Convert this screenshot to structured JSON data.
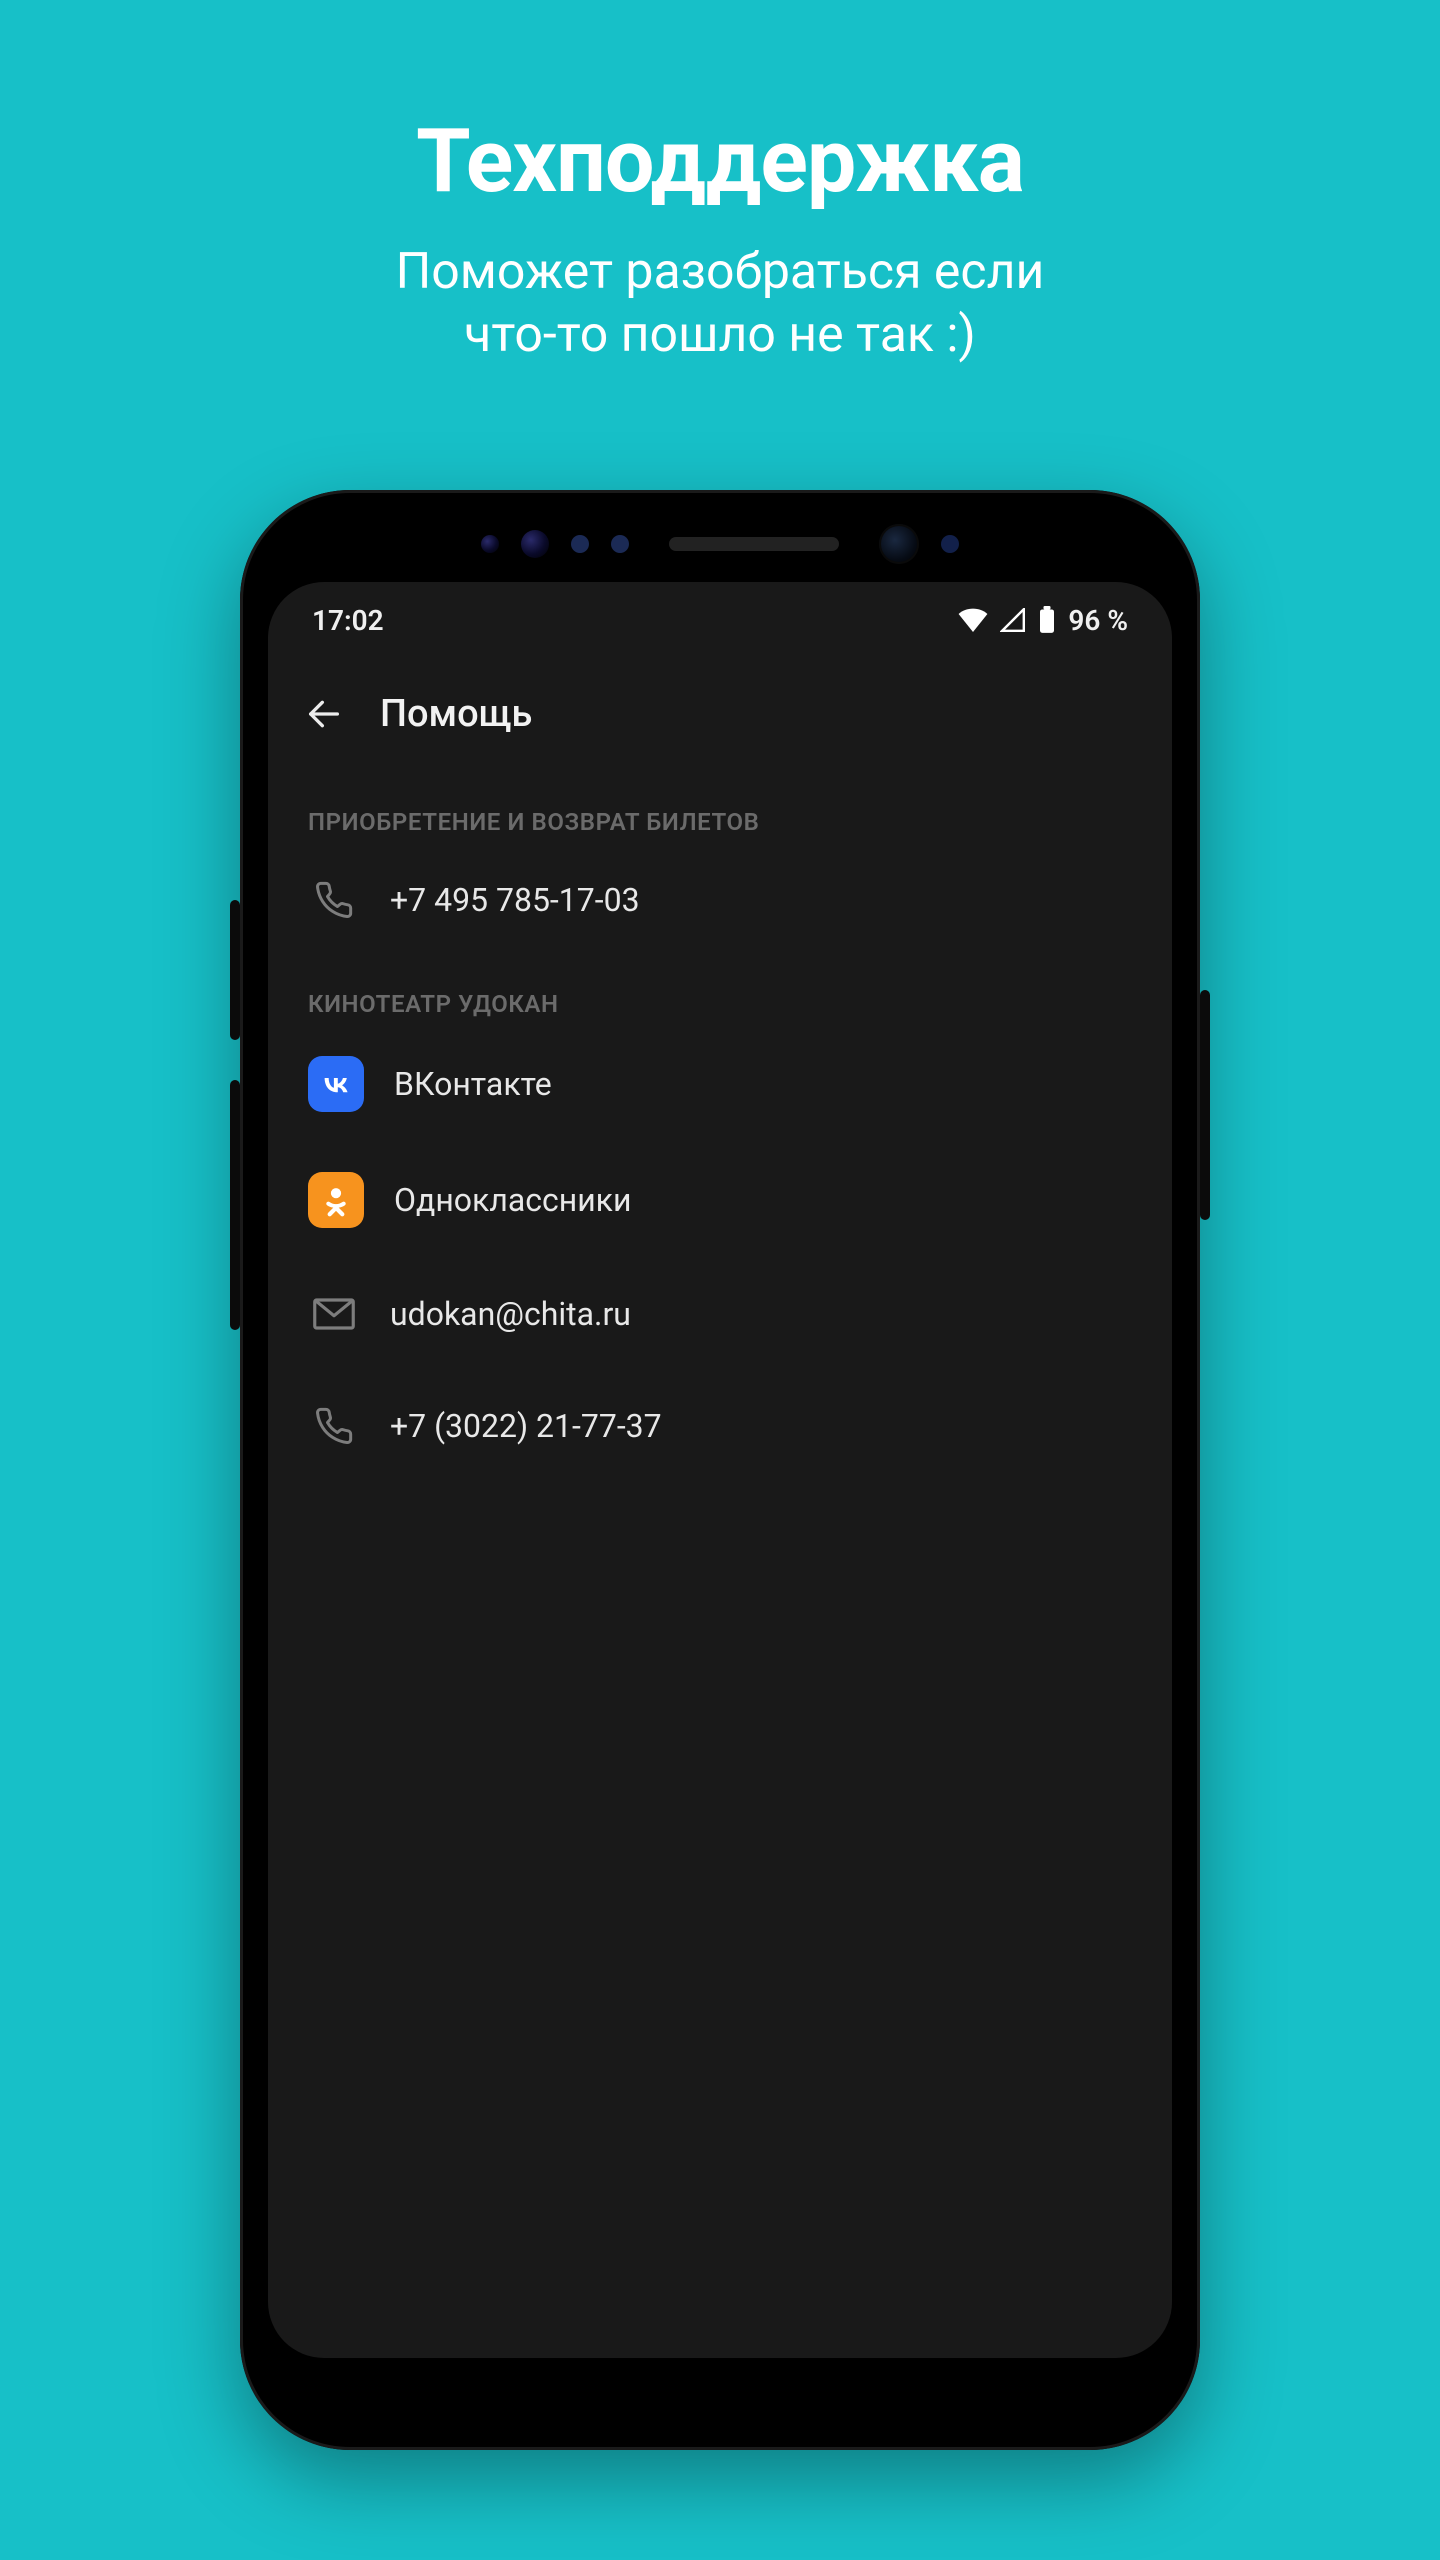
{
  "promo": {
    "title": "Техподдержка",
    "subtitle_line1": "Поможет разобраться если",
    "subtitle_line2": "что-то пошло не так :)"
  },
  "status": {
    "time": "17:02",
    "battery_text": "96 %"
  },
  "header": {
    "title": "Помощь"
  },
  "sections": [
    {
      "label": "ПРИОБРЕТЕНИЕ И ВОЗВРАТ БИЛЕТОВ",
      "items": [
        {
          "icon": "phone",
          "label": "+7 495 785-17-03"
        }
      ]
    },
    {
      "label": "КИНОТЕАТР УДОКАН",
      "items": [
        {
          "icon": "vk",
          "label": "ВКонтакте"
        },
        {
          "icon": "ok",
          "label": "Одноклассники"
        },
        {
          "icon": "email",
          "label": "udokan@chita.ru"
        },
        {
          "icon": "phone",
          "label": "+7 (3022) 21-77-37"
        }
      ]
    }
  ]
}
